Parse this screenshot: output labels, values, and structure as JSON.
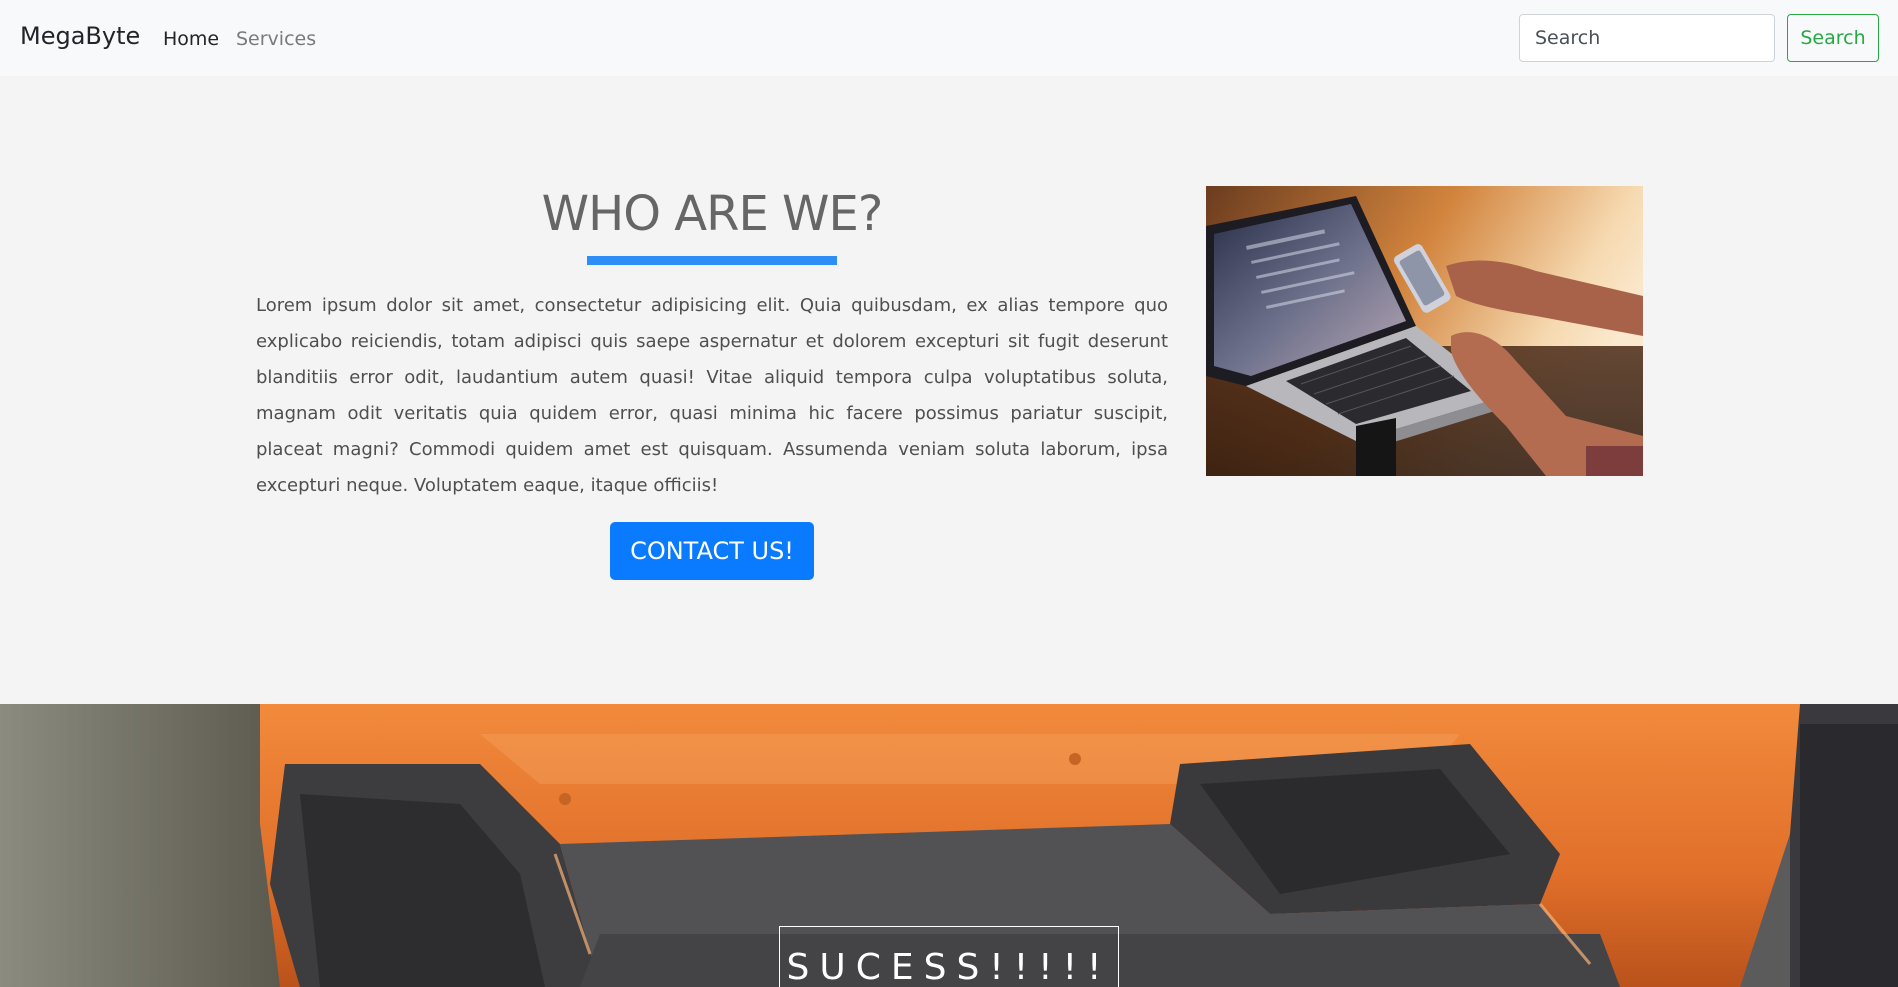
{
  "navbar": {
    "brand": "MegaByte",
    "links": [
      "Home",
      "Services"
    ],
    "search_placeholder": "Search",
    "search_button": "Search"
  },
  "about": {
    "title": "WHO ARE WE?",
    "text": "Lorem ipsum dolor sit amet, consectetur adipisicing elit. Quia quibusdam, ex alias tempore quo explicabo reiciendis, totam adipisci quis saepe aspernatur et dolorem excepturi sit fugit deserunt blanditiis error odit, laudantium autem quasi! Vitae aliquid tempora culpa voluptatibus soluta, magnam odit veritatis quia quidem error, quasi minima hic facere possimus pariatur suscipit, placeat magni? Commodi quidem amet est quisquam. Assumenda veniam soluta laborum, ipsa excepturi neque. Voluptatem eaque, itaque officiis!",
    "button": "CONTACT US!"
  },
  "banner": {
    "text": "SUCESS!!!!!"
  },
  "colors": {
    "accent": "#0a7bff",
    "underline": "#2e8ef7",
    "search_green": "#28a745",
    "car_orange": "#e8772f"
  },
  "icons": {
    "about_image": "laptop-photo",
    "banner_image": "orange-sports-car-photo"
  }
}
